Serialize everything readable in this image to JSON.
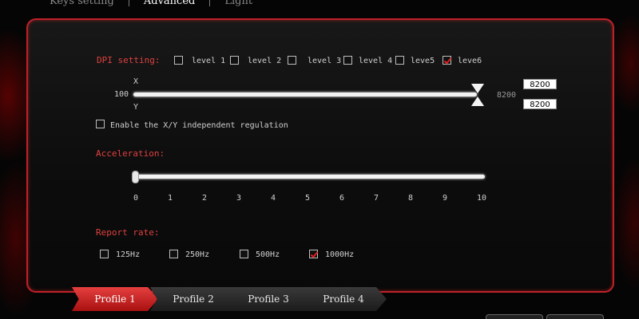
{
  "top_tabs": [
    "Keys setting",
    "Advanced",
    "Light"
  ],
  "dpi": {
    "label": "DPI setting:",
    "levels": [
      {
        "label": "level 1",
        "checked": false
      },
      {
        "label": "level 2",
        "checked": false
      },
      {
        "label": "level 3",
        "checked": false
      },
      {
        "label": "level 4",
        "checked": false
      },
      {
        "label": "leve5",
        "checked": false
      },
      {
        "label": "leve6",
        "checked": true
      }
    ],
    "axis_x": "X",
    "axis_y": "Y",
    "min": "100",
    "max": "8200",
    "x_value": "8200",
    "y_value": "8200",
    "independent_label": "Enable the X/Y independent regulation",
    "independent_checked": false
  },
  "acceleration": {
    "label": "Acceleration:",
    "ticks": [
      "0",
      "1",
      "2",
      "3",
      "4",
      "5",
      "6",
      "7",
      "8",
      "9",
      "10"
    ],
    "value": 0
  },
  "report_rate": {
    "label": "Report rate:",
    "options": [
      {
        "label": "125Hz",
        "checked": false
      },
      {
        "label": "250Hz",
        "checked": false
      },
      {
        "label": "500Hz",
        "checked": false
      },
      {
        "label": "1000Hz",
        "checked": true
      }
    ]
  },
  "profiles": [
    "Profile 1",
    "Profile 2",
    "Profile 3",
    "Profile 4"
  ],
  "active_profile": 0,
  "colors": {
    "accent": "#e04040",
    "border": "#c0202a"
  }
}
